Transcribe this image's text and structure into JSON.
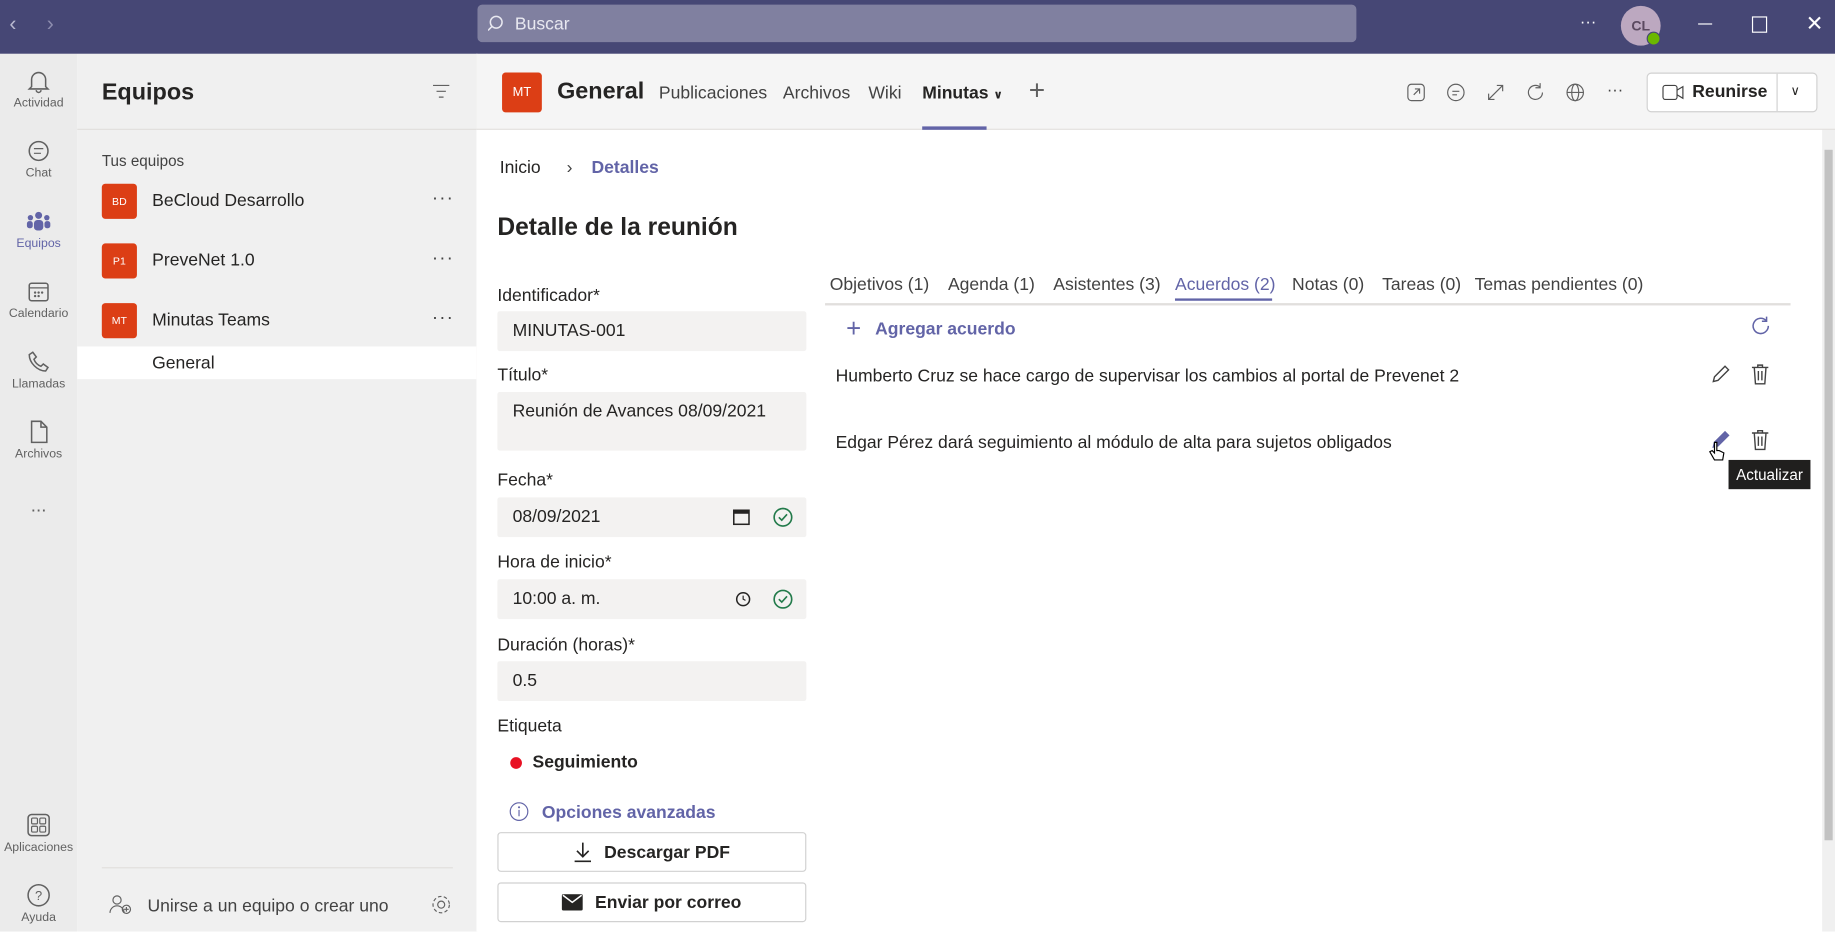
{
  "titlebar": {
    "search_placeholder": "Buscar",
    "avatar_initials": "CL",
    "more_icon": "ellipsis-icon",
    "status": "available"
  },
  "rail": {
    "items": [
      {
        "label": "Actividad",
        "icon": "bell-icon"
      },
      {
        "label": "Chat",
        "icon": "chat-icon"
      },
      {
        "label": "Equipos",
        "icon": "teams-icon",
        "active": true
      },
      {
        "label": "Calendario",
        "icon": "calendar-icon"
      },
      {
        "label": "Llamadas",
        "icon": "phone-icon"
      },
      {
        "label": "Archivos",
        "icon": "file-icon"
      },
      {
        "label": "..."
      }
    ],
    "bottom": [
      {
        "label": "Aplicaciones",
        "icon": "apps-icon"
      },
      {
        "label": "Ayuda",
        "icon": "help-icon"
      }
    ]
  },
  "teams_panel": {
    "title": "Equipos",
    "section": "Tus equipos",
    "teams": [
      {
        "initials": "BD",
        "name": "BeCloud Desarrollo"
      },
      {
        "initials": "P1",
        "name": "PreveNet 1.0"
      },
      {
        "initials": "MT",
        "name": "Minutas Teams"
      }
    ],
    "channel": "General",
    "join_label": "Unirse a un equipo o crear uno"
  },
  "header": {
    "avatar": "MT",
    "channel": "General",
    "tabs": [
      "Publicaciones",
      "Archivos",
      "Wiki",
      "Minutas"
    ],
    "active_tab": "Minutas",
    "join_button": "Reunirse"
  },
  "breadcrumb": {
    "home": "Inicio",
    "current": "Detalles"
  },
  "page_title": "Detalle de la reunión",
  "form": {
    "id_label": "Identificador*",
    "id_value": "MINUTAS-001",
    "title_label": "Título*",
    "title_value": "Reunión  de Avances 08/09/2021",
    "date_label": "Fecha*",
    "date_value": "08/09/2021",
    "time_label": "Hora de inicio*",
    "time_value": "10:00  a. m.",
    "duration_label": "Duración (horas)*",
    "duration_value": "0.5",
    "tag_label": "Etiqueta",
    "tag_value": "Seguimiento",
    "tag_color": "#e81123",
    "advanced": "Opciones avanzadas",
    "pdf_button": "Descargar PDF",
    "email_button": "Enviar por correo"
  },
  "detail_tabs": [
    "Objetivos (1)",
    "Agenda (1)",
    "Asistentes (3)",
    "Acuerdos (2)",
    "Notas (0)",
    "Tareas (0)",
    "Temas pendientes (0)"
  ],
  "active_detail_tab": "Acuerdos (2)",
  "agreements": {
    "add_label": "Agregar acuerdo",
    "items": [
      "Humberto Cruz se hace cargo de supervisar los cambios al portal de Prevenet 2",
      "Edgar Pérez dará seguimiento al módulo de alta para sujetos obligados"
    ],
    "tooltip": "Actualizar"
  },
  "colors": {
    "titlebar": "#464775",
    "accent": "#6264a7",
    "team_avatar": "#dc3e15",
    "success": "#237b4b"
  }
}
